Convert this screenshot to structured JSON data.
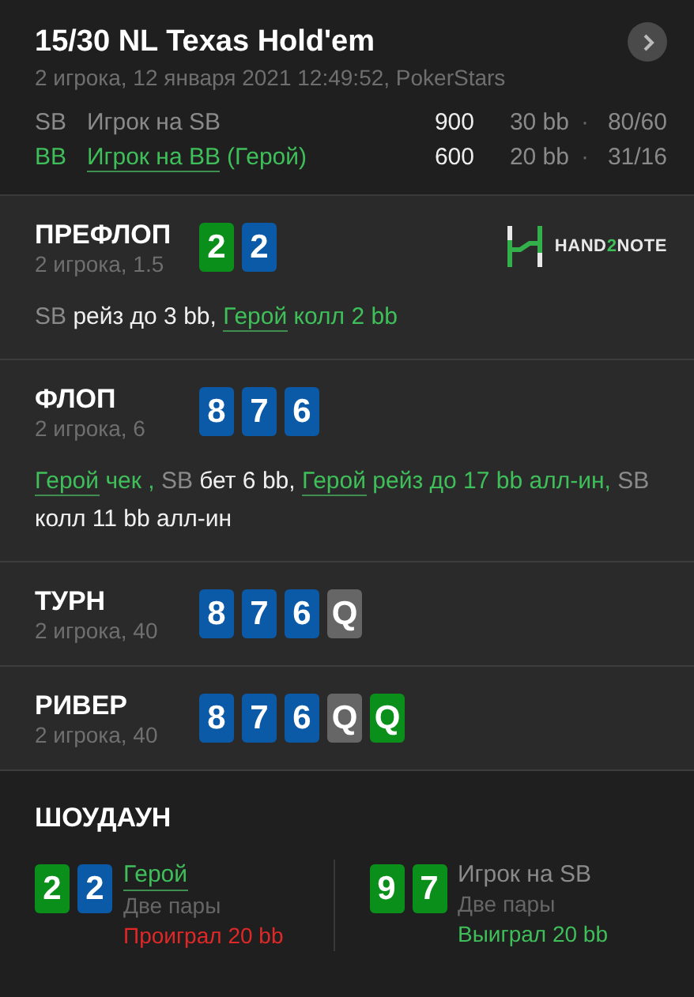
{
  "header": {
    "title": "15/30 NL Texas Hold'em",
    "subtitle": "2 игрока, 12 января 2021 12:49:52, PokerStars",
    "players": [
      {
        "position": "SB",
        "name": "Игрок на SB",
        "hero": false,
        "stack": "900",
        "bb": "30 bb",
        "separator": "·",
        "stats": "80/60"
      },
      {
        "position": "BB",
        "name": "Игрок на BB",
        "hero": true,
        "hero_tag": "(Герой)",
        "stack": "600",
        "bb": "20 bb",
        "separator": "·",
        "stats": "31/16"
      }
    ]
  },
  "logo": {
    "before": "HAND",
    "accent": "2",
    "after": "NOTE"
  },
  "streets": [
    {
      "name": "ПРЕФЛОП",
      "info": "2 игрока, 1.5",
      "cards": [
        {
          "rank": "2",
          "color": "#0a8f1a"
        },
        {
          "rank": "2",
          "color": "#0b5aa8"
        }
      ],
      "actions": [
        {
          "player": "SB",
          "hero": false,
          "text": "рейз до 3 bb,"
        },
        {
          "player": "Герой",
          "hero": true,
          "text": "колл 2 bb"
        }
      ]
    },
    {
      "name": "ФЛОП",
      "info": "2 игрока, 6",
      "cards": [
        {
          "rank": "8",
          "color": "#0b5aa8"
        },
        {
          "rank": "7",
          "color": "#0b5aa8"
        },
        {
          "rank": "6",
          "color": "#0b5aa8"
        }
      ],
      "actions": [
        {
          "player": "Герой",
          "hero": true,
          "text": "чек ,"
        },
        {
          "player": "SB",
          "hero": false,
          "text": "бет 6 bb,"
        },
        {
          "player": "Герой",
          "hero": true,
          "text": "рейз до 17 bb алл-ин,"
        },
        {
          "player": "SB",
          "hero": false,
          "text": "колл 11 bb алл-ин"
        }
      ]
    },
    {
      "name": "ТУРН",
      "info": "2 игрока, 40",
      "cards": [
        {
          "rank": "8",
          "color": "#0b5aa8"
        },
        {
          "rank": "7",
          "color": "#0b5aa8"
        },
        {
          "rank": "6",
          "color": "#0b5aa8"
        },
        {
          "rank": "Q",
          "color": "#666666"
        }
      ]
    },
    {
      "name": "РИВЕР",
      "info": "2 игрока, 40",
      "cards": [
        {
          "rank": "8",
          "color": "#0b5aa8"
        },
        {
          "rank": "7",
          "color": "#0b5aa8"
        },
        {
          "rank": "6",
          "color": "#0b5aa8"
        },
        {
          "rank": "Q",
          "color": "#666666"
        },
        {
          "rank": "Q",
          "color": "#0a8f1a"
        }
      ]
    }
  ],
  "showdown": {
    "title": "ШОУДАУН",
    "players": [
      {
        "name": "Герой",
        "hero": true,
        "hand": "Две пары",
        "result": "Проиграл 20 bb",
        "won": false,
        "cards": [
          {
            "rank": "2",
            "color": "#0a8f1a"
          },
          {
            "rank": "2",
            "color": "#0b5aa8"
          }
        ]
      },
      {
        "name": "Игрок на SB",
        "hero": false,
        "hand": "Две пары",
        "result": "Выиграл 20 bb",
        "won": true,
        "cards": [
          {
            "rank": "9",
            "color": "#0a8f1a"
          },
          {
            "rank": "7",
            "color": "#0a8f1a"
          }
        ]
      }
    ]
  }
}
